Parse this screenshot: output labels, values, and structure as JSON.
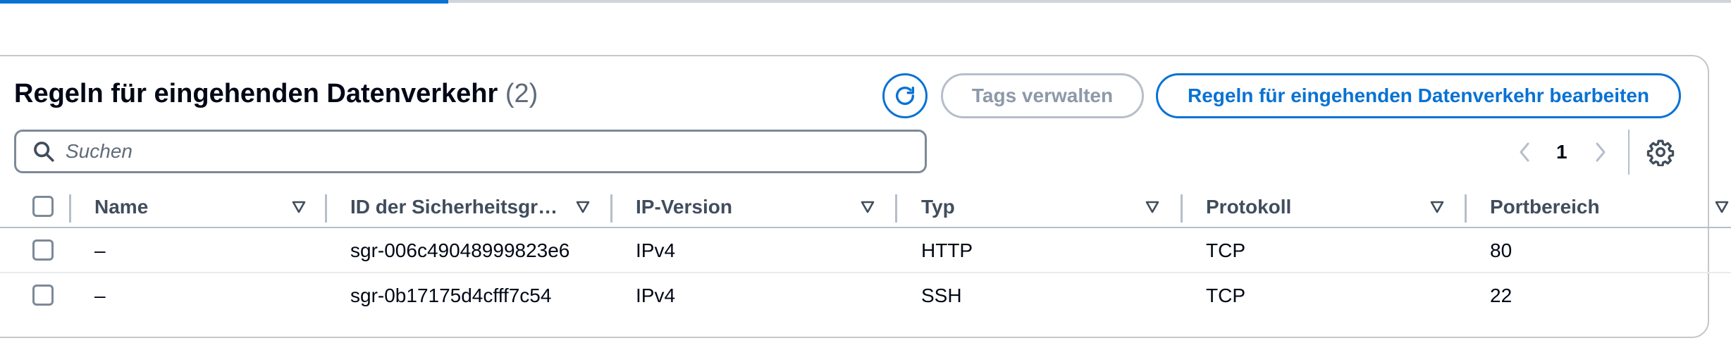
{
  "panel": {
    "title": "Regeln für eingehenden Datenverkehr",
    "count": "(2)"
  },
  "actions": {
    "refresh_icon": "refresh-icon",
    "manage_tags_label": "Tags verwalten",
    "edit_rules_label": "Regeln für eingehenden Datenverkehr bearbeiten"
  },
  "search": {
    "placeholder": "Suchen",
    "value": ""
  },
  "pagination": {
    "current_page": "1"
  },
  "table": {
    "columns": [
      "Name",
      "ID der Sicherheitsgr…",
      "IP-Version",
      "Typ",
      "Protokoll",
      "Portbereich"
    ],
    "rows": [
      {
        "name": "–",
        "id": "sgr-006c49048999823e6",
        "ip_version": "IPv4",
        "type": "HTTP",
        "protocol": "TCP",
        "port_range": "80"
      },
      {
        "name": "–",
        "id": "sgr-0b17175d4cfff7c54",
        "ip_version": "IPv4",
        "type": "SSH",
        "protocol": "TCP",
        "port_range": "22"
      }
    ]
  },
  "colors": {
    "accent": "#0972d3",
    "disabled": "#8d99a8",
    "border": "#7d8998"
  }
}
